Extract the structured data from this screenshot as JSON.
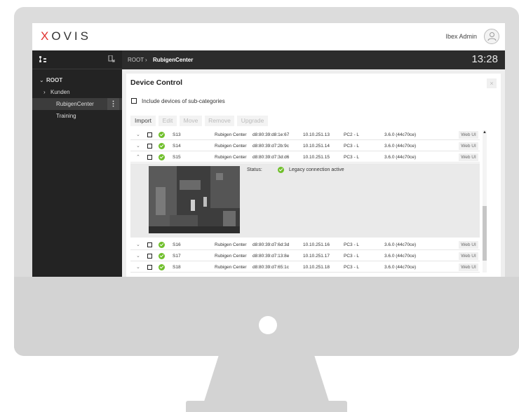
{
  "app": {
    "logo_mark": "X",
    "logo_rest": "OVIS",
    "user_name": "Ibex Admin"
  },
  "sidebar": {
    "items": [
      {
        "label": "ROOT",
        "prefix": "⌄"
      },
      {
        "label": "Kunden",
        "prefix": "›"
      },
      {
        "label": "RubigenCenter",
        "active": true
      },
      {
        "label": "Training"
      }
    ]
  },
  "breadcrumb": {
    "root": "ROOT",
    "separator": "›",
    "current": "RubigenCenter",
    "clock": "13:28"
  },
  "panel": {
    "title": "Device Control",
    "close_icon": "×",
    "include_label": "Include devices of sub-categories"
  },
  "toolbar": {
    "import": "Import",
    "edit": "Edit",
    "move": "Move",
    "remove": "Remove",
    "upgrade": "Upgrade"
  },
  "devices": [
    {
      "chev": "⌄",
      "name": "S13",
      "location": "Rubigen Center",
      "mac": "d8:80:39:d8:1e:67",
      "ip": "10.10.251.13",
      "model": "PC2 - L",
      "fw": "3.6.0 (44c70ce)",
      "web": "Web UI"
    },
    {
      "chev": "⌄",
      "name": "S14",
      "location": "Rubigen Center",
      "mac": "d8:80:39:d7:2b:9c",
      "ip": "10.10.251.14",
      "model": "PC3 - L",
      "fw": "3.6.0 (44c70ce)",
      "web": "Web UI"
    },
    {
      "chev": "⌃",
      "name": "S15",
      "location": "Rubigen Center",
      "mac": "d8:80:39:d7:3d:d6",
      "ip": "10.10.251.15",
      "model": "PC3 - L",
      "fw": "3.6.0 (44c70ce)",
      "web": "Web UI"
    },
    {
      "chev": "⌄",
      "name": "S16",
      "location": "Rubigen Center",
      "mac": "d8:80:39:d7:6d:3d",
      "ip": "10.10.251.16",
      "model": "PC3 - L",
      "fw": "3.6.0 (44c70ce)",
      "web": "Web UI"
    },
    {
      "chev": "⌄",
      "name": "S17",
      "location": "Rubigen Center",
      "mac": "d8:80:39:d7:13:8e",
      "ip": "10.10.251.17",
      "model": "PC3 - L",
      "fw": "3.6.0 (44c70ce)",
      "web": "Web UI"
    },
    {
      "chev": "⌄",
      "name": "S18",
      "location": "Rubigen Center",
      "mac": "d8:80:39:d7:65:1c",
      "ip": "10.10.251.18",
      "model": "PC3 - L",
      "fw": "3.6.0 (44c70ce)",
      "web": "Web UI"
    }
  ],
  "detail": {
    "status_label": "Status:",
    "status_text": "Legacy connection active"
  },
  "icons": {
    "tree": "tree-icon",
    "pin": "pin-icon",
    "avatar": "user-icon",
    "status_ok": "check-circle-icon"
  },
  "colors": {
    "brand_red": "#e0312f",
    "ok_green": "#6fbf2a",
    "sidebar_bg": "#232323"
  }
}
